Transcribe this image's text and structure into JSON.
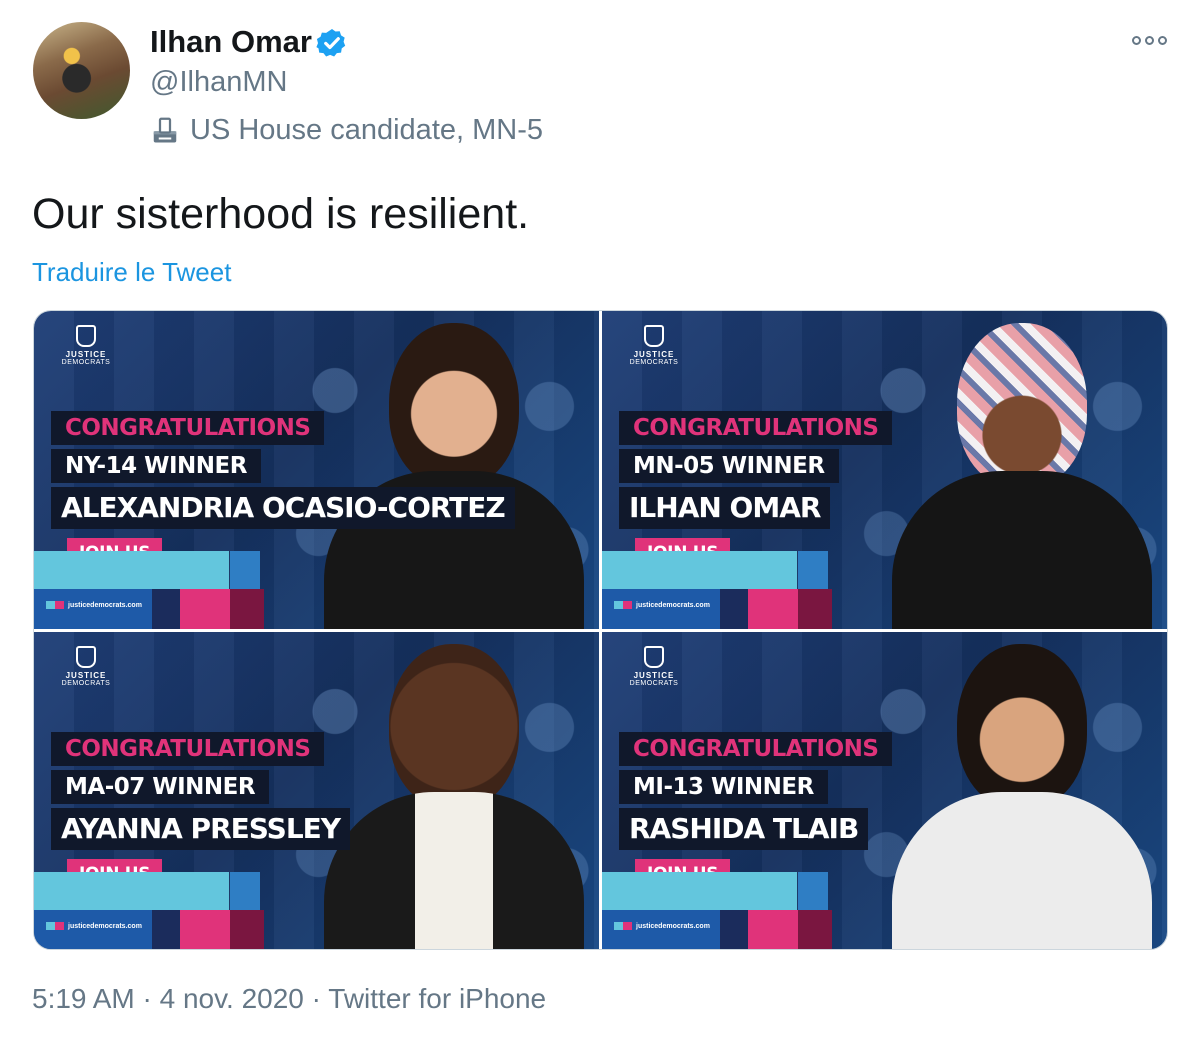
{
  "author": {
    "display_name": "Ilhan Omar",
    "handle": "@IlhanMN",
    "bio_label": "US House candidate, MN-5",
    "bio_icon": "ballot-box-icon",
    "verified_icon": "verified-badge-icon",
    "verified_color": "#1da1f2"
  },
  "more_icon": "more-options-icon",
  "tweet": {
    "text": "Our sisterhood is resilient.",
    "translate_label": "Traduire le Tweet"
  },
  "media": {
    "cards": [
      {
        "logo_line1": "JUSTICE",
        "logo_line2": "DEMOCRATS",
        "congrats": "CONGRATULATIONS",
        "district": "NY-14 WINNER",
        "name": "ALEXANDRIA OCASIO-CORTEZ",
        "join": "JOIN US",
        "url": "justicedemocrats.com"
      },
      {
        "logo_line1": "JUSTICE",
        "logo_line2": "DEMOCRATS",
        "congrats": "CONGRATULATIONS",
        "district": "MN-05 WINNER",
        "name": "ILHAN OMAR",
        "join": "JOIN US",
        "url": "justicedemocrats.com"
      },
      {
        "logo_line1": "JUSTICE",
        "logo_line2": "DEMOCRATS",
        "congrats": "CONGRATULATIONS",
        "district": "MA-07 WINNER",
        "name": "AYANNA PRESSLEY",
        "join": "JOIN US",
        "url": "justicedemocrats.com"
      },
      {
        "logo_line1": "JUSTICE",
        "logo_line2": "DEMOCRATS",
        "congrats": "CONGRATULATIONS",
        "district": "MI-13 WINNER",
        "name": "RASHIDA TLAIB",
        "join": "JOIN US",
        "url": "justicedemocrats.com"
      }
    ],
    "colors": {
      "background": "#1f3f78",
      "accent_pink": "#e0337a",
      "accent_cyan": "#63c6dd",
      "label_bg": "#10182b"
    }
  },
  "footer": {
    "meta": "5:19 AM · 4 nov. 2020 · Twitter for iPhone"
  }
}
